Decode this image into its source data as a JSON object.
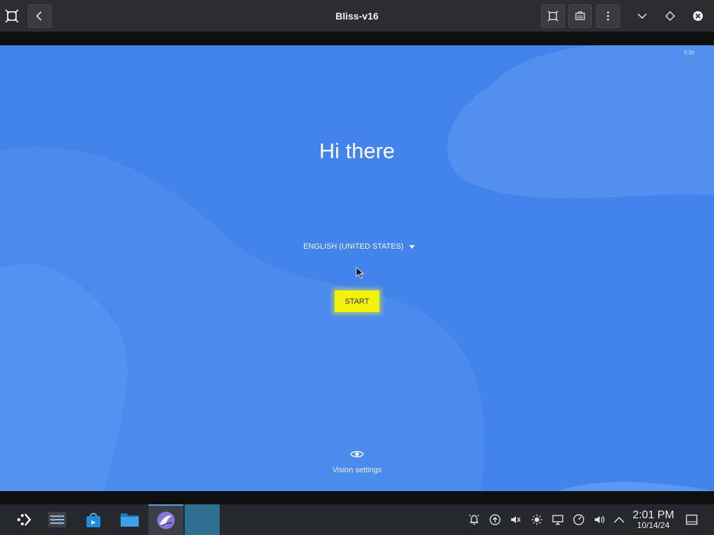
{
  "window": {
    "title": "Bliss-v16"
  },
  "setup": {
    "corner_text": "6:3s",
    "greeting": "Hi there",
    "language": "ENGLISH (UNITED STATES)",
    "start_label": "START",
    "vision_label": "Vision settings"
  },
  "tray": {
    "time": "2:01 PM",
    "date": "10/14/24"
  },
  "colors": {
    "screen_bg": "#4283ec",
    "start_button": "#f2f20a",
    "taskbar": "#25282d",
    "titlebar": "#2c2d30"
  }
}
